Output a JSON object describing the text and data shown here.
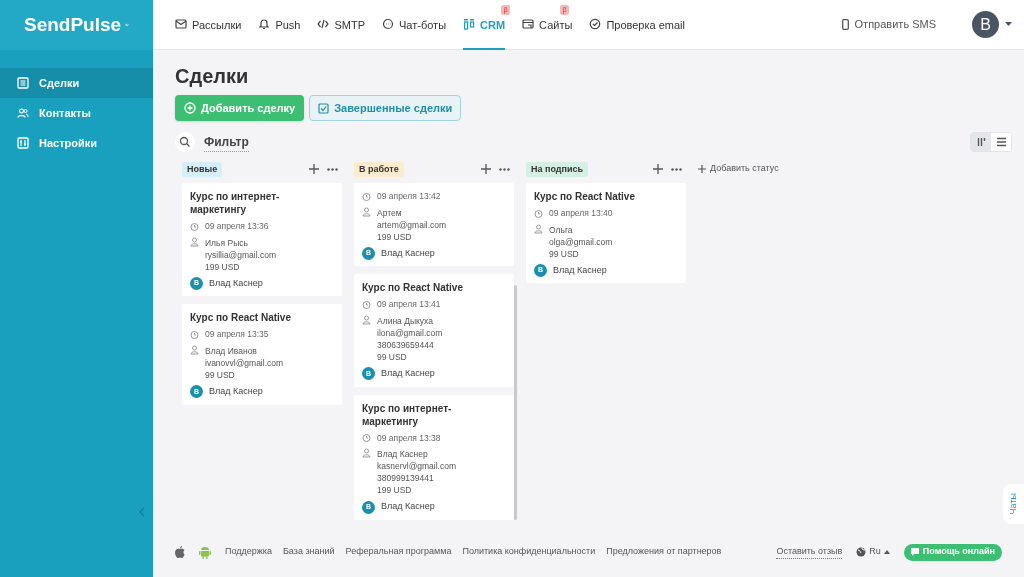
{
  "logo": {
    "text": "SendPulse"
  },
  "nav": [
    {
      "label": "Рассылки",
      "selected": false
    },
    {
      "label": "Push",
      "selected": false
    },
    {
      "label": "SMTP",
      "selected": false
    },
    {
      "label": "Чат-боты",
      "selected": false
    },
    {
      "label": "CRM",
      "selected": true,
      "badge": "β"
    },
    {
      "label": "Сайты",
      "selected": false,
      "badge": "β"
    },
    {
      "label": "Проверка email",
      "selected": false
    }
  ],
  "send_sms": "Отправить SMS",
  "user_avatar": "B",
  "sidebar": {
    "items": [
      {
        "label": "Сделки",
        "selected": true
      },
      {
        "label": "Контакты",
        "selected": false
      },
      {
        "label": "Настройки",
        "selected": false
      }
    ]
  },
  "page_title": "Сделки",
  "buttons": {
    "add": "Добавить сделку",
    "completed": "Завершенные сделки"
  },
  "filter": "Фильтр",
  "view_toggle": [
    {
      "kind": "board",
      "selected": true
    },
    {
      "kind": "list",
      "selected": false
    }
  ],
  "add_status": "Добавить статус",
  "columns": [
    {
      "title": "Новые",
      "color": "#d6eef8",
      "cards": [
        {
          "title": "Курс по интернет-маркетингу",
          "date": "09 апреля 13:36",
          "contact_lines": [
            "Илья Рысь",
            "rysillia@gmail.com",
            "199 USD"
          ],
          "owner_initial": "B",
          "owner": "Влад Каснер"
        },
        {
          "title": "Курс по React Native",
          "date": "09 апреля 13:35",
          "contact_lines": [
            "Влад Иванов",
            "ivanovvl@gmail.com",
            "99 USD"
          ],
          "owner_initial": "B",
          "owner": "Влад Каснер"
        }
      ]
    },
    {
      "title": "В работе",
      "color": "#fbecd0",
      "cards": [
        {
          "date": "09 апреля 13:42",
          "contact_lines": [
            "Артем",
            "artem@gmail.com",
            "199 USD"
          ],
          "owner_initial": "B",
          "owner": "Влад Каснер"
        },
        {
          "title": "Курс по React Native",
          "date": "09 апреля 13:41",
          "contact_lines": [
            "Алина Дыкуха",
            "ilona@gmail.com",
            "380639659444",
            "99 USD"
          ],
          "owner_initial": "B",
          "owner": "Влад Каснер"
        },
        {
          "title": "Курс по интернет-маркетингу",
          "date": "09 апреля 13:38",
          "contact_lines": [
            "Влад Каснер",
            "kasnervl@gmail.com",
            "380999139441",
            "199 USD"
          ],
          "owner_initial": "B",
          "owner": "Влад Каснер"
        }
      ]
    },
    {
      "title": "На подпись",
      "color": "#d5f0e3",
      "cards": [
        {
          "title": "Курс по React Native",
          "date": "09 апреля 13:40",
          "contact_lines": [
            "Ольга",
            "olga@gmail.com",
            "99 USD"
          ],
          "owner_initial": "B",
          "owner": "Влад Каснер"
        }
      ]
    }
  ],
  "footer": {
    "links": [
      "Поддержка",
      "База знаний",
      "Реферальная программа",
      "Политика конфиденциальности",
      "Предложения от партнеров"
    ],
    "feedback": "Оставить отзыв",
    "language": "Ru",
    "help": "Помощь онлайн"
  },
  "chats_tab": "Чаты"
}
